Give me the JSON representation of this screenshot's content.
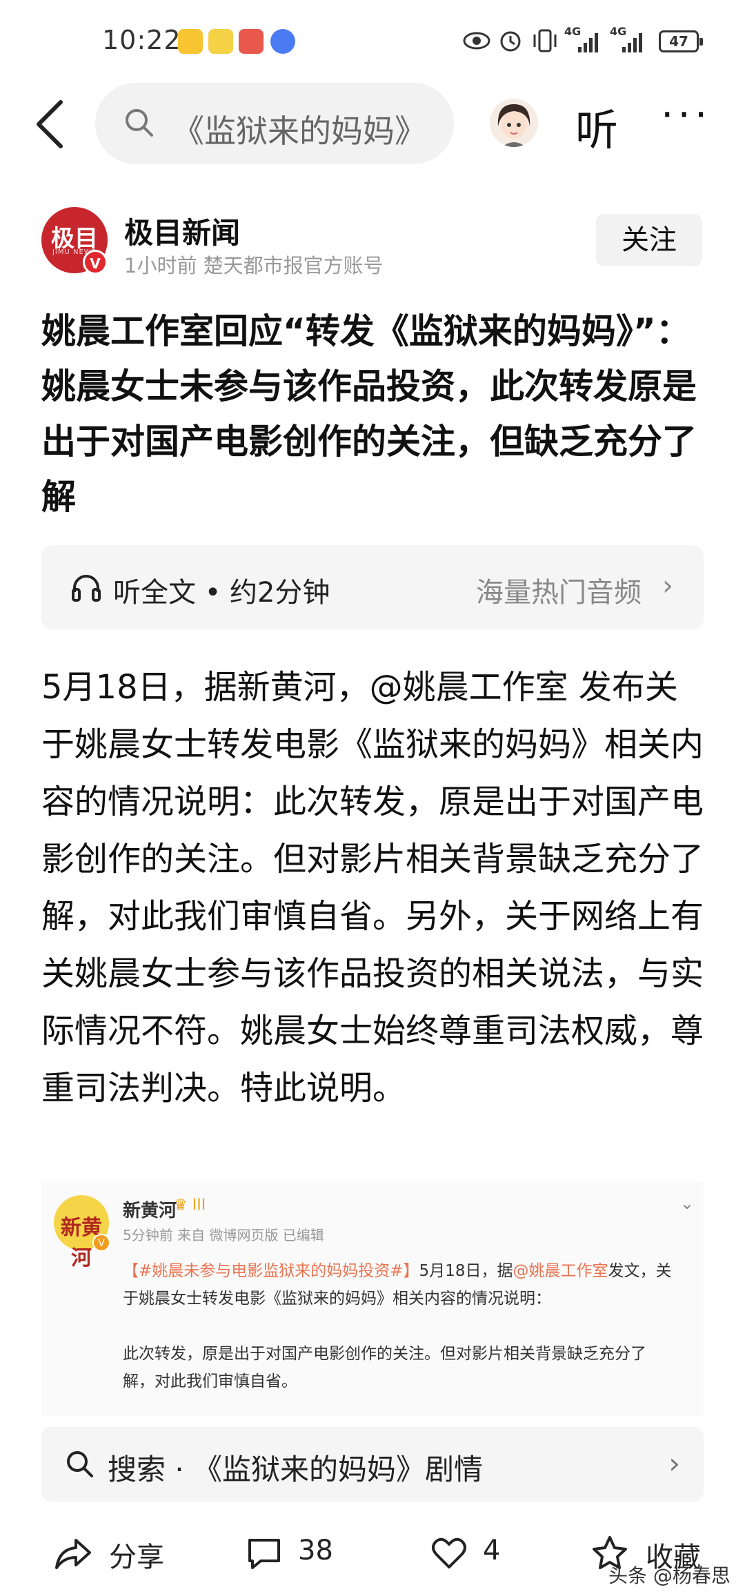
{
  "status_bar": {
    "time": "10:22",
    "signal_1": "4G",
    "signal_2": "4G",
    "battery": "47"
  },
  "top_nav": {
    "search_query": "《监狱来的妈妈》",
    "listen_label": "听",
    "more_label": "···"
  },
  "author": {
    "logo_text": "极目",
    "logo_sub": "JIMU NEWS",
    "verified_badge": "V",
    "name": "极目新闻",
    "meta": "1小时前   楚天都市报官方账号",
    "follow_label": "关注"
  },
  "article": {
    "headline": "姚晨工作室回应“转发《监狱来的妈妈》”：姚晨女士未参与该作品投资，此次转发原是出于对国产电影创作的关注，但缺乏充分了解",
    "listen_bar": {
      "label": "听全文 • 约2分钟",
      "hot_audio": "海量热门音频",
      "chevron": "›"
    },
    "body": "5月18日，据新黄河，@姚晨工作室 发布关于姚晨女士转发电影《监狱来的妈妈》相关内容的情况说明：此次转发，原是出于对国产电影创作的关注。但对影片相关背景缺乏充分了解，对此我们审慎自省。另外，关于网络上有关姚晨女士参与该作品投资的相关说法，与实际情况不符。姚晨女士始终尊重司法权威，尊重司法判决。特此说明。"
  },
  "embed": {
    "logo_text": "新黄河",
    "badge": "V",
    "name": "新黄河",
    "vip": "♛ III",
    "meta": "5分钟前  来自 微博网页版 已编辑",
    "chevron": "⌄",
    "hashtag": "【#姚晨未参与电影监狱来的妈妈投资#】",
    "text_1": "5月18日，据",
    "mention": "@姚晨工作室",
    "text_2": "发文，关于姚晨女士转发电影《监狱来的妈妈》相关内容的情况说明：",
    "text_3": "此次转发，原是出于对国产电影创作的关注。但对影片相关背景缺乏充分了解，对此我们审慎自省。"
  },
  "related_search": {
    "text": "搜索 · 《监狱来的妈妈》剧情",
    "chevron": "›"
  },
  "actions": {
    "share_label": "分享",
    "comment_count": "38",
    "like_count": "4",
    "favorite_label": "收藏"
  },
  "watermark": "头条 @杨春思"
}
